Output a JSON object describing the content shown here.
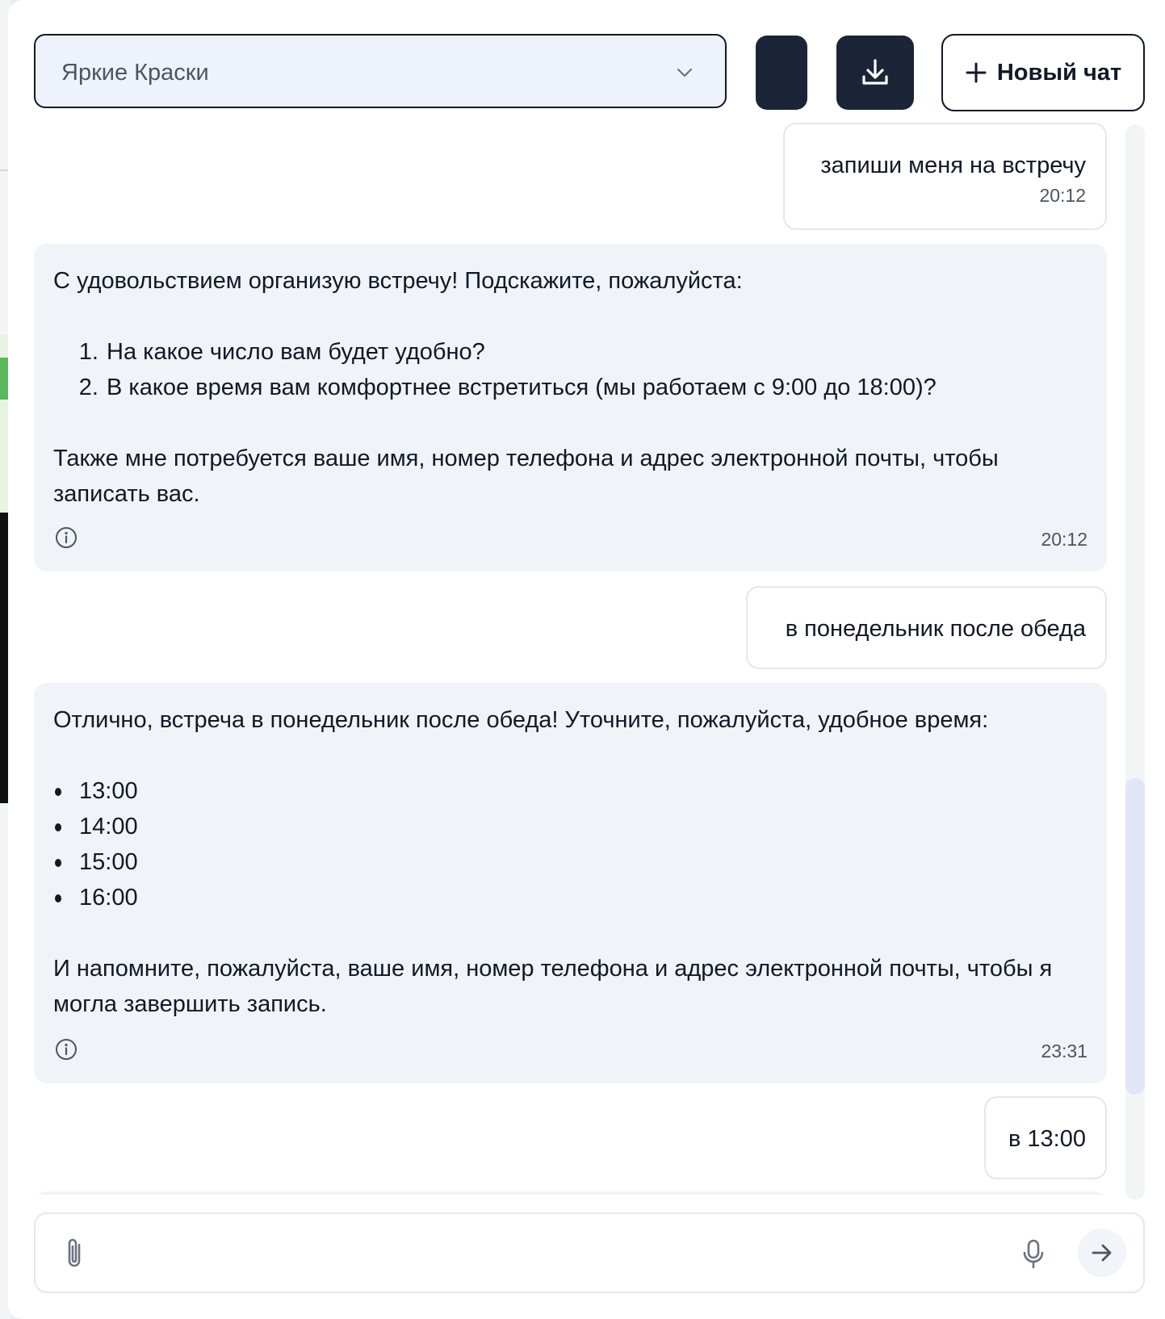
{
  "header": {
    "assistant_select": {
      "value": "Яркие Краски"
    },
    "new_chat_label": "Новый чат"
  },
  "messages": [
    {
      "role": "user",
      "text": "запиши меня на встречу",
      "time": "20:12"
    },
    {
      "role": "assistant",
      "intro": "С удовольствием организую встречу! Подскажите, пожалуйста:",
      "items": [
        "На какое число вам будет удобно?",
        "В какое время вам комфортнее встретиться (мы работаем с 9:00 до 18:00)?"
      ],
      "outro": "Также мне потребуется ваше имя, номер телефона и адрес электронной почты, чтобы записать вас.",
      "time": "20:12"
    },
    {
      "role": "user",
      "text": "в понедельник после обеда"
    },
    {
      "role": "assistant",
      "intro": "Отлично, встреча в понедельник после обеда! Уточните, пожалуйста, удобное время:",
      "items": [
        "13:00",
        "14:00",
        "15:00",
        "16:00"
      ],
      "outro": "И напомните, пожалуйста, ваше имя, номер телефона и адрес электронной почты, чтобы я могла завершить запись.",
      "time": "23:31"
    },
    {
      "role": "user",
      "text": "в 13:00"
    }
  ],
  "composer": {
    "placeholder": ""
  },
  "icons": {
    "chevron": "chevron-down-icon",
    "download": "download-icon",
    "plus": "plus-icon",
    "info": "info-icon",
    "attach": "paperclip-icon",
    "mic": "microphone-icon",
    "send": "arrow-right-icon"
  },
  "colors": {
    "dark_button": "#1b2537",
    "assistant_bubble": "#f0f3f8",
    "selector_bg": "#eef3fb",
    "scroll_thumb": "#e0e6f6"
  }
}
